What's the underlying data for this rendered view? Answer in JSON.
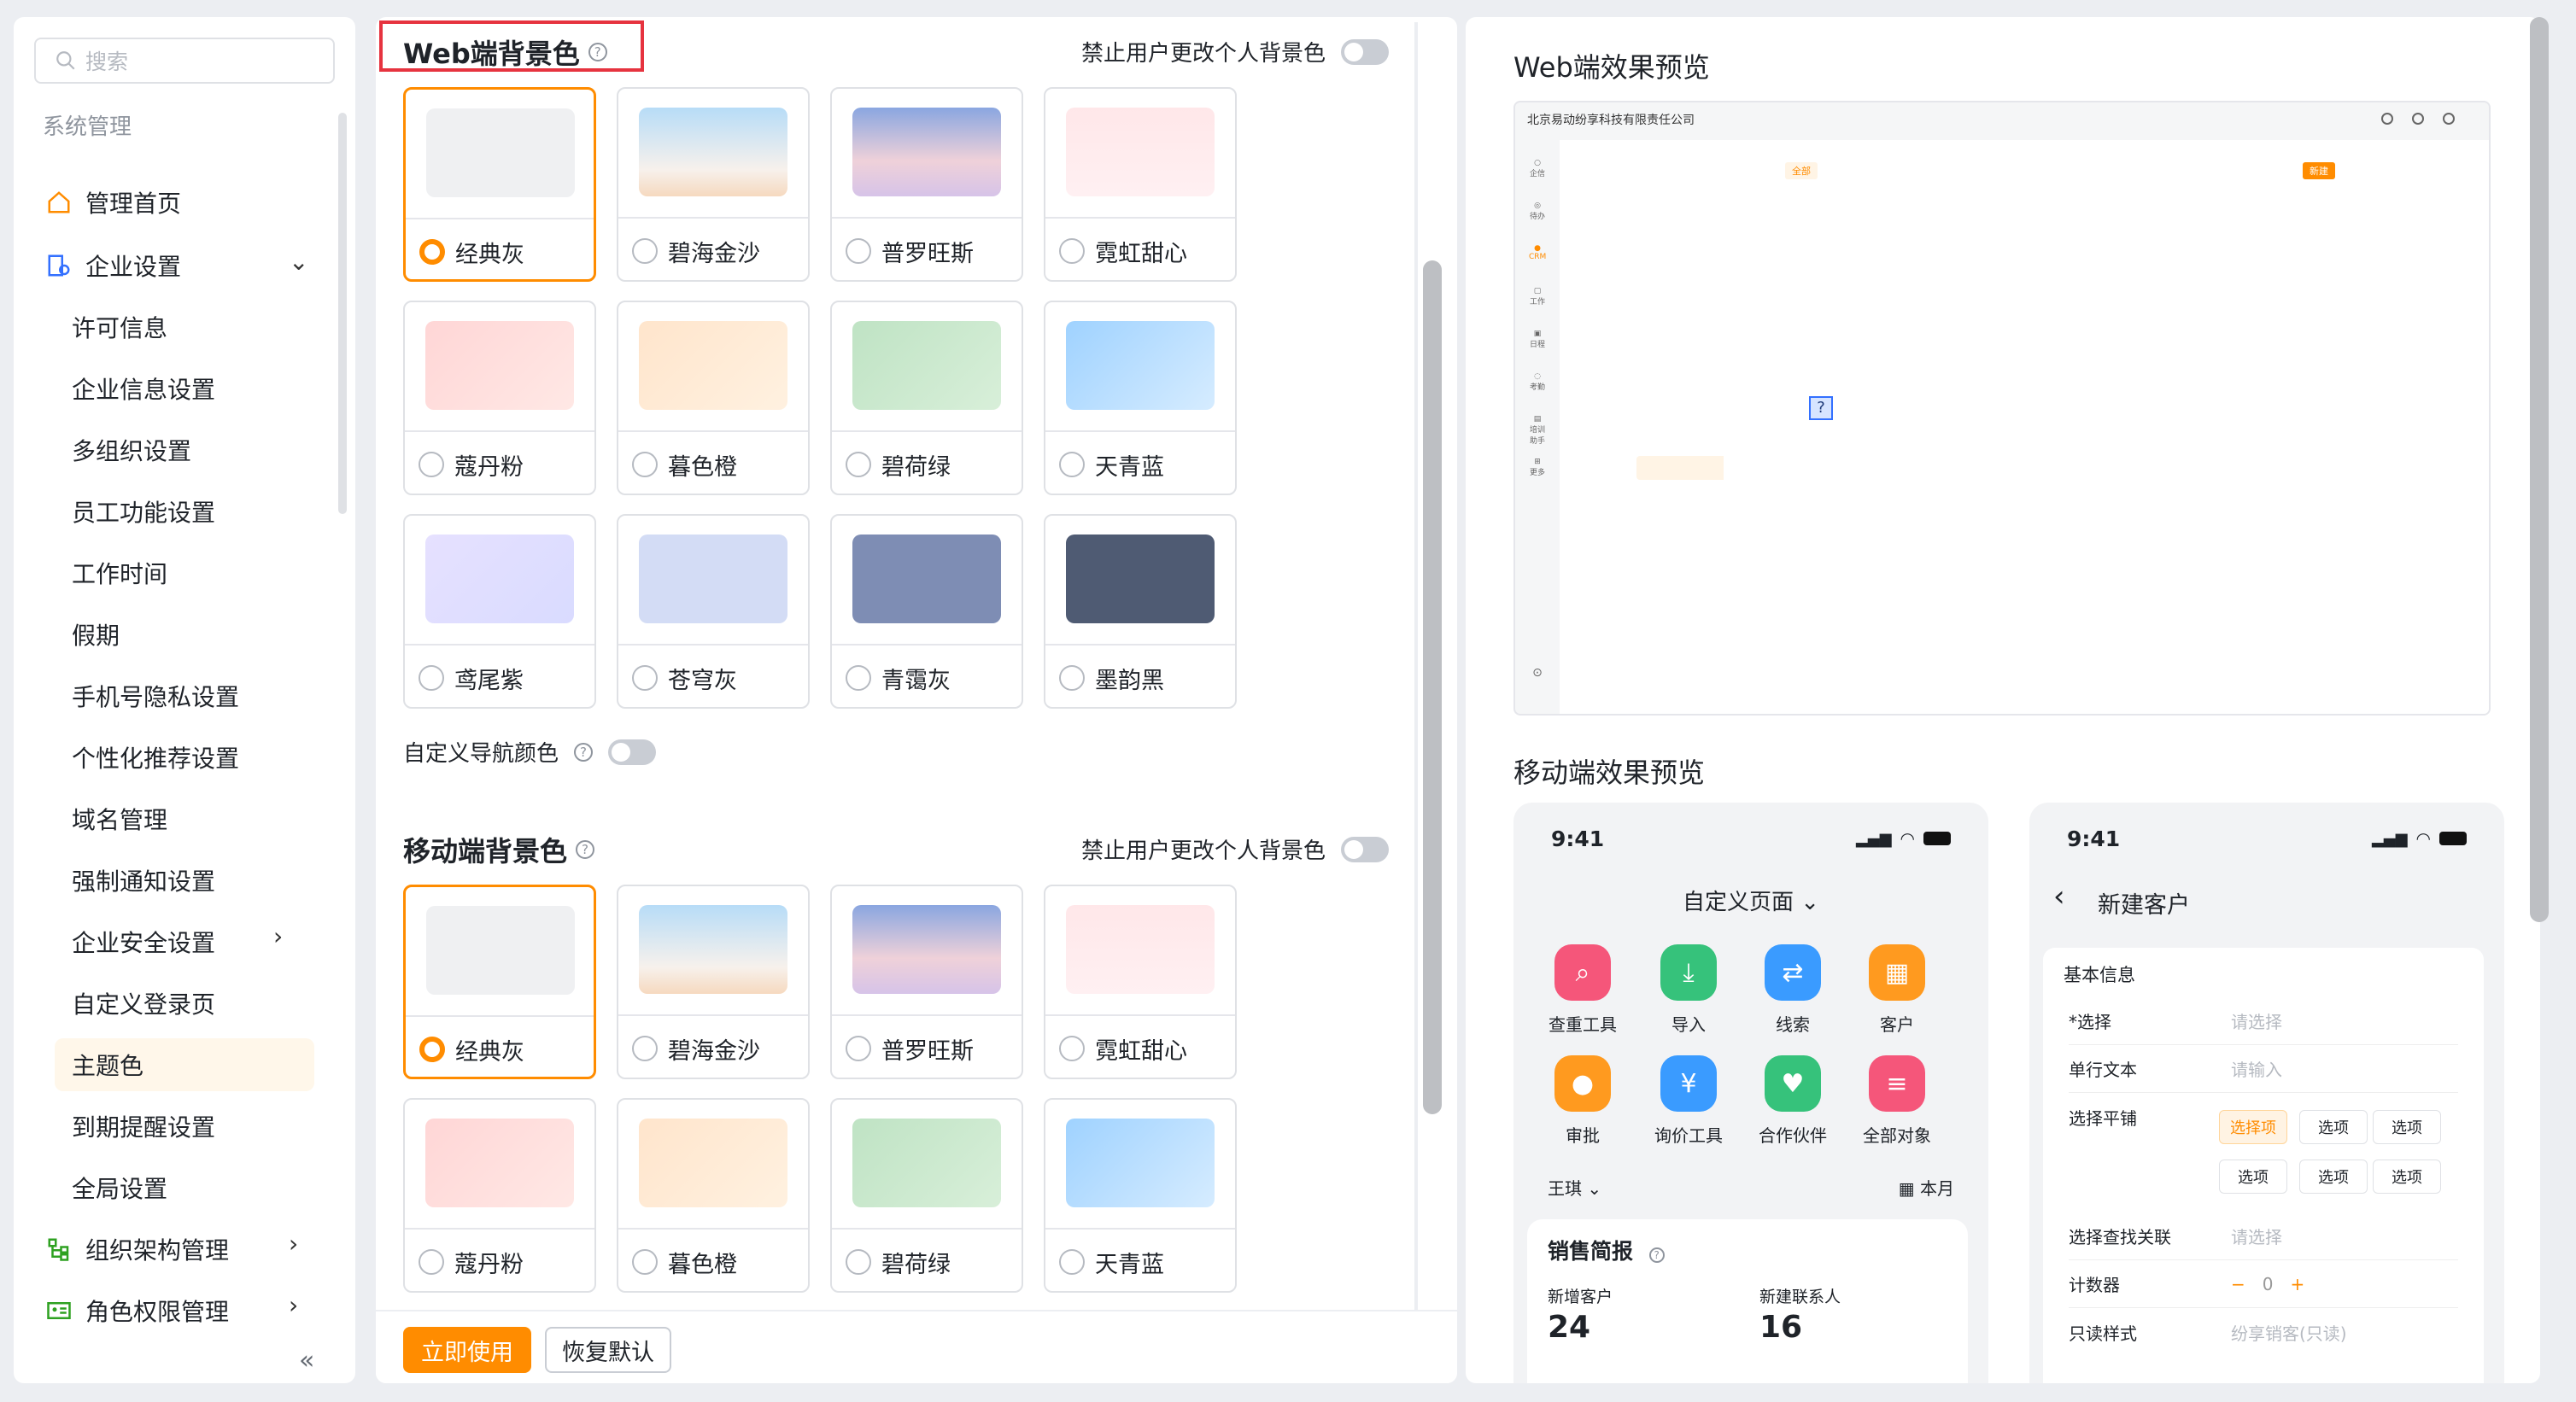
{
  "sidebar": {
    "search_placeholder": "搜索",
    "section_title": "系统管理",
    "items": [
      {
        "label": "管理首页"
      },
      {
        "label": "企业设置"
      },
      {
        "label": "许可信息"
      },
      {
        "label": "企业信息设置"
      },
      {
        "label": "多组织设置"
      },
      {
        "label": "员工功能设置"
      },
      {
        "label": "工作时间"
      },
      {
        "label": "假期"
      },
      {
        "label": "手机号隐私设置"
      },
      {
        "label": "个性化推荐设置"
      },
      {
        "label": "域名管理"
      },
      {
        "label": "强制通知设置"
      },
      {
        "label": "企业安全设置"
      },
      {
        "label": "自定义登录页"
      },
      {
        "label": "主题色"
      },
      {
        "label": "到期提醒设置"
      },
      {
        "label": "全局设置"
      },
      {
        "label": "组织架构管理"
      },
      {
        "label": "角色权限管理"
      }
    ],
    "collapse_glyph": "«"
  },
  "web_bg": {
    "title": "Web端背景色",
    "lock_label": "禁止用户更改个人背景色",
    "options": [
      {
        "label": "经典灰"
      },
      {
        "label": "碧海金沙"
      },
      {
        "label": "普罗旺斯"
      },
      {
        "label": "霓虹甜心"
      },
      {
        "label": "蔻丹粉"
      },
      {
        "label": "暮色橙"
      },
      {
        "label": "碧荷绿"
      },
      {
        "label": "天青蓝"
      },
      {
        "label": "鸢尾紫"
      },
      {
        "label": "苍穹灰"
      },
      {
        "label": "青霭灰"
      },
      {
        "label": "墨韵黑"
      }
    ],
    "custom_nav_label": "自定义导航颜色"
  },
  "mobile_bg": {
    "title": "移动端背景色",
    "lock_label": "禁止用户更改个人背景色",
    "options": [
      {
        "label": "经典灰"
      },
      {
        "label": "碧海金沙"
      },
      {
        "label": "普罗旺斯"
      },
      {
        "label": "霓虹甜心"
      },
      {
        "label": "蔻丹粉"
      },
      {
        "label": "暮色橙"
      },
      {
        "label": "碧荷绿"
      },
      {
        "label": "天青蓝"
      }
    ]
  },
  "footer": {
    "apply_label": "立即使用",
    "reset_label": "恢复默认"
  },
  "preview": {
    "web_title": "Web端效果预览",
    "company": "北京易动纷享科技有限责任公司",
    "nav": [
      "企信",
      "待办",
      "CRM",
      "工作",
      "日程",
      "考勤",
      "培训助手",
      "更多"
    ],
    "chip_all": "全部",
    "chip_new": "新建",
    "mobile_title": "移动端效果预览",
    "phone1": {
      "time": "9:41",
      "header": "自定义页面",
      "apps": [
        "查重工具",
        "导入",
        "线索",
        "客户",
        "审批",
        "询价工具",
        "合作伙伴",
        "全部对象"
      ],
      "user": "王琪",
      "period": "本月",
      "report_title": "销售简报",
      "metric1": "新增客户",
      "metric2": "新建联系人",
      "metric1_value": "24",
      "metric2_value": "16"
    },
    "phone2": {
      "time": "9:41",
      "back": "‹",
      "title": "新建客户",
      "section": "基本信息",
      "rows": [
        {
          "k": "*选择",
          "v": "请选择"
        },
        {
          "k": "单行文本",
          "v": "请输入"
        },
        {
          "k": "选择平铺",
          "v": ""
        },
        {
          "k": "选择查找关联",
          "v": "请选择"
        },
        {
          "k": "计数器",
          "v": "0"
        },
        {
          "k": "只读样式",
          "v": "纷享销客(只读)"
        }
      ],
      "options": [
        "选择项",
        "选项",
        "选项",
        "选项",
        "选项",
        "选项"
      ]
    }
  },
  "colors": {
    "accent": "#ff8c00",
    "highlight": "#e6333f"
  }
}
